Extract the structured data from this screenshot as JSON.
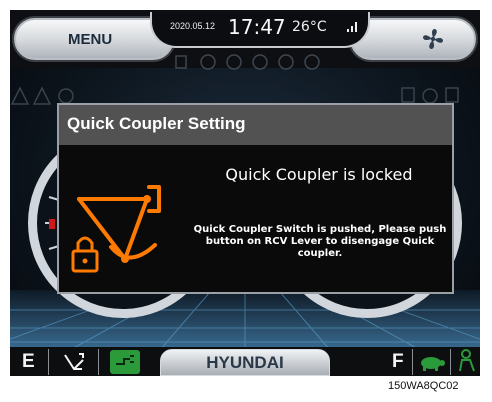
{
  "top_bar": {
    "menu_label": "MENU",
    "date": "2020.05.12",
    "time": "17:47",
    "temperature": "26°C",
    "signal_icon": "signal-bars-icon",
    "fan_icon": "fan-icon"
  },
  "dialog": {
    "title": "Quick Coupler Setting",
    "heading": "Quick Coupler is locked",
    "message": "Quick Coupler Switch is pushed, Please push button on RCV Lever to disengage Quick coupler.",
    "icon": "quick-coupler-locked-icon"
  },
  "bottom_bar": {
    "left_label": "E",
    "brand": "HYUNDAI",
    "right_label": "F",
    "icons": [
      "coupler-icon",
      "fuel-plug-icon",
      "turtle-icon",
      "operator-icon"
    ]
  },
  "caption": "150WA8QC02",
  "colors": {
    "accent_orange": "#ff7a00",
    "dialog_header": "#525252",
    "indicator_green": "#2a9a3a"
  }
}
